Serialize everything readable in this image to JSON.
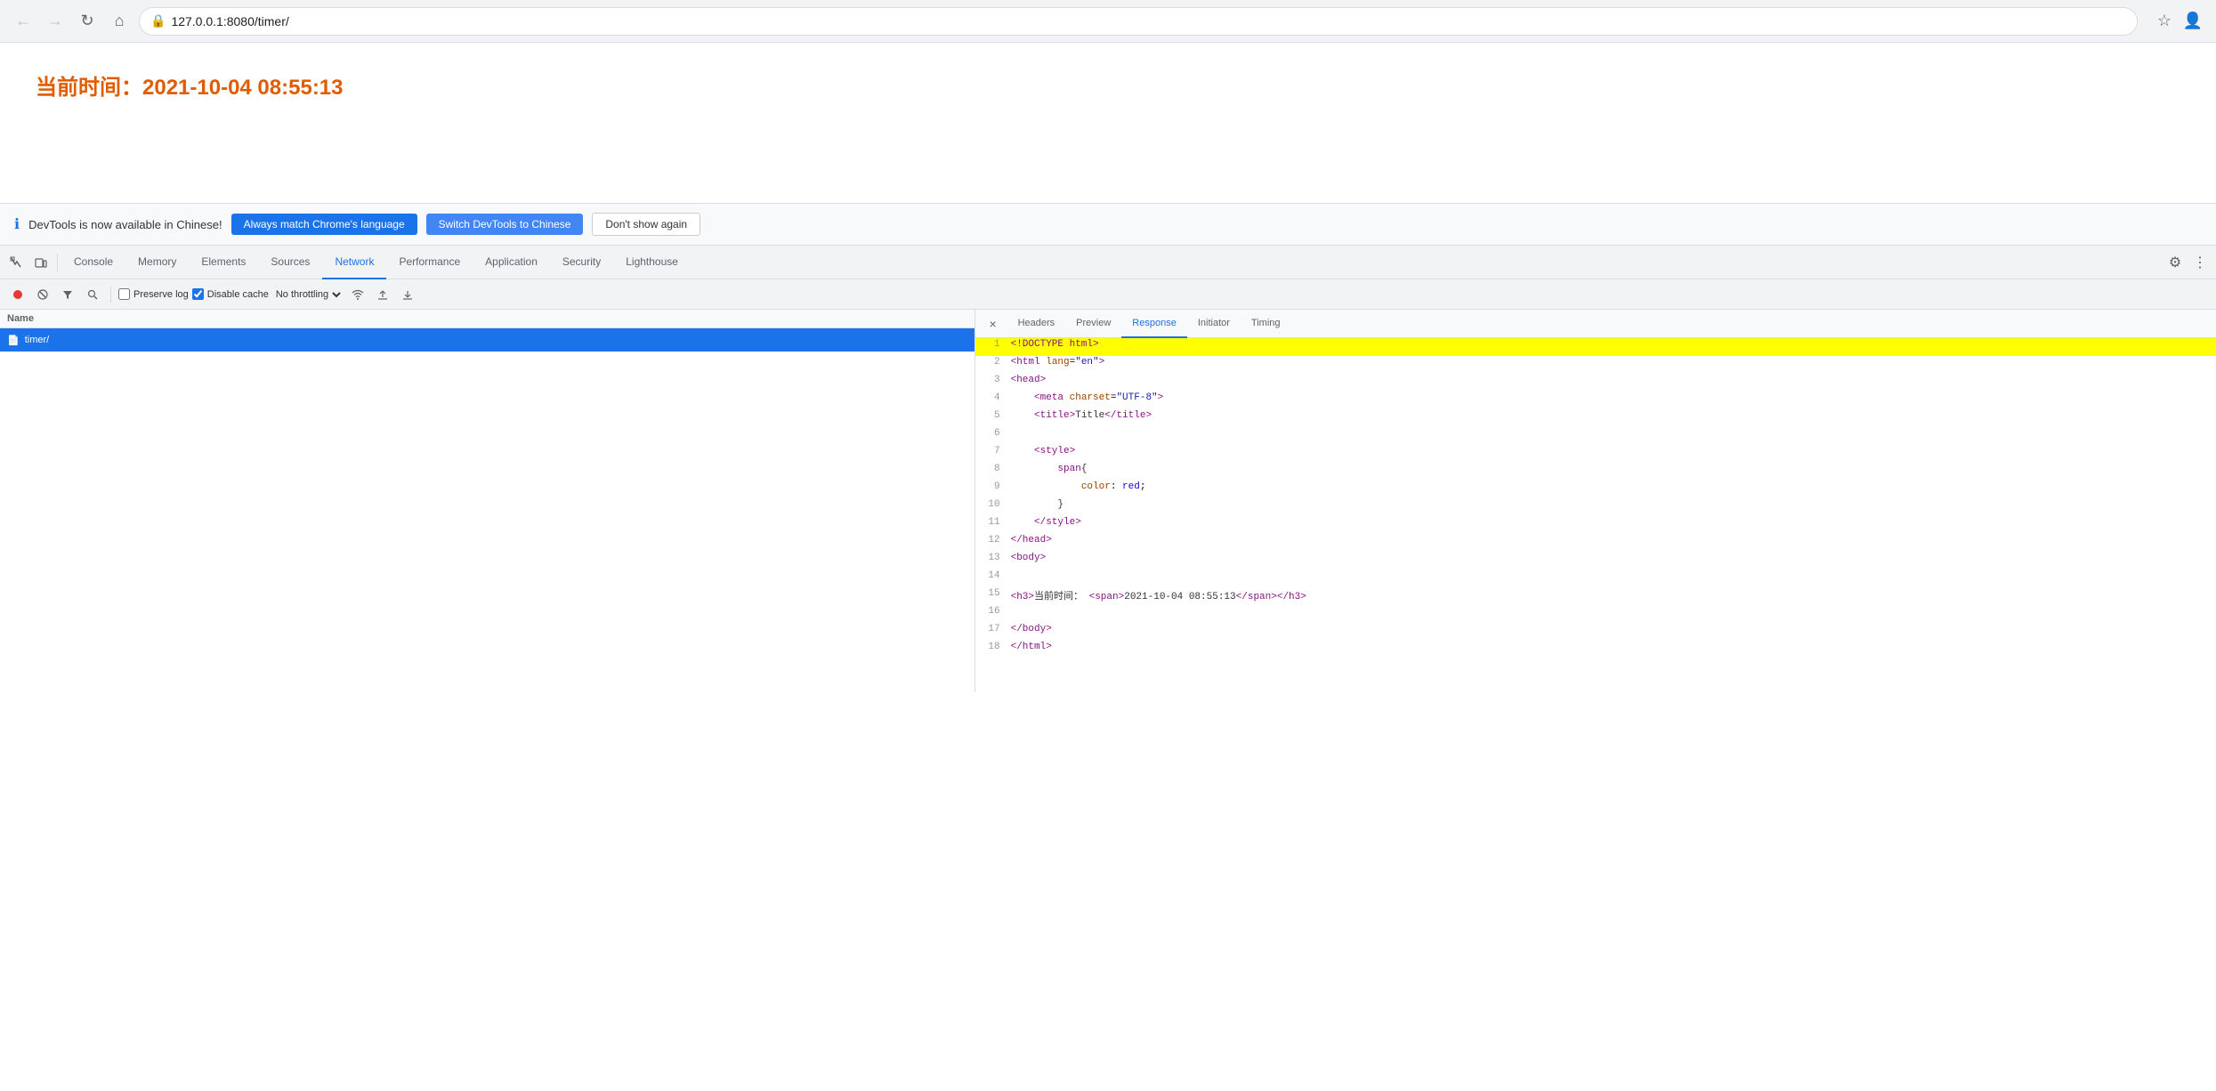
{
  "browser": {
    "url": "127.0.0.1:8080/timer/",
    "back_btn": "←",
    "forward_btn": "→",
    "reload_btn": "↺",
    "home_btn": "⌂",
    "star_btn": "☆",
    "profile_btn": "👤"
  },
  "page": {
    "title_prefix": "当前时间：",
    "title_time": "2021-10-04 08:55:13"
  },
  "banner": {
    "info_icon": "ℹ",
    "message": "DevTools is now available in Chinese!",
    "btn1_label": "Always match Chrome's language",
    "btn2_label": "Switch DevTools to Chinese",
    "btn3_label": "Don't show again"
  },
  "devtools": {
    "tabs": [
      {
        "id": "console",
        "label": "Console",
        "active": false
      },
      {
        "id": "memory",
        "label": "Memory",
        "active": false
      },
      {
        "id": "elements",
        "label": "Elements",
        "active": false
      },
      {
        "id": "sources",
        "label": "Sources",
        "active": false
      },
      {
        "id": "network",
        "label": "Network",
        "active": true
      },
      {
        "id": "performance",
        "label": "Performance",
        "active": false
      },
      {
        "id": "application",
        "label": "Application",
        "active": false
      },
      {
        "id": "security",
        "label": "Security",
        "active": false
      },
      {
        "id": "lighthouse",
        "label": "Lighthouse",
        "active": false
      }
    ],
    "toolbar": {
      "preserve_log": "Preserve log",
      "disable_cache": "Disable cache",
      "throttle_label": "No throttling"
    },
    "network_list": {
      "column_header": "Name",
      "items": [
        {
          "id": "timer",
          "name": "timer/",
          "icon": "📄",
          "selected": true
        }
      ]
    },
    "response_panel": {
      "tabs": [
        {
          "id": "headers",
          "label": "Headers",
          "active": false
        },
        {
          "id": "preview",
          "label": "Preview",
          "active": false
        },
        {
          "id": "response",
          "label": "Response",
          "active": true
        },
        {
          "id": "initiator",
          "label": "Initiator",
          "active": false
        },
        {
          "id": "timing",
          "label": "Timing",
          "active": false
        }
      ],
      "code_lines": [
        {
          "num": 1,
          "content": "<!DOCTYPE html>",
          "highlighted": true,
          "type": "doctype"
        },
        {
          "num": 2,
          "content": "<html lang=\"en\">",
          "highlighted": false,
          "type": "tag"
        },
        {
          "num": 3,
          "content": "<head>",
          "highlighted": false,
          "type": "tag"
        },
        {
          "num": 4,
          "content": "    <meta charset=\"UTF-8\">",
          "highlighted": false,
          "type": "tag"
        },
        {
          "num": 5,
          "content": "    <title>Title</title>",
          "highlighted": false,
          "type": "tag"
        },
        {
          "num": 6,
          "content": "",
          "highlighted": false,
          "type": "empty"
        },
        {
          "num": 7,
          "content": "    <style>",
          "highlighted": false,
          "type": "tag"
        },
        {
          "num": 8,
          "content": "        span{",
          "highlighted": false,
          "type": "css"
        },
        {
          "num": 9,
          "content": "            color: red;",
          "highlighted": false,
          "type": "css"
        },
        {
          "num": 10,
          "content": "        }",
          "highlighted": false,
          "type": "css"
        },
        {
          "num": 11,
          "content": "    </style>",
          "highlighted": false,
          "type": "tag"
        },
        {
          "num": 12,
          "content": "</head>",
          "highlighted": false,
          "type": "tag"
        },
        {
          "num": 13,
          "content": "<body>",
          "highlighted": false,
          "type": "tag"
        },
        {
          "num": 14,
          "content": "",
          "highlighted": false,
          "type": "empty"
        },
        {
          "num": 15,
          "content_parts": [
            {
              "text": "<h3>",
              "class": "html-tag"
            },
            {
              "text": "当前时间：",
              "class": "html-text"
            },
            {
              "text": " <span>",
              "class": "html-tag"
            },
            {
              "text": "2021-10-04 08:55:13",
              "class": "html-text"
            },
            {
              "text": "</span>",
              "class": "html-tag"
            },
            {
              "text": "</h3>",
              "class": "html-tag"
            }
          ],
          "highlighted": false,
          "type": "mixed"
        },
        {
          "num": 16,
          "content": "",
          "highlighted": false,
          "type": "empty"
        },
        {
          "num": 17,
          "content": "</body>",
          "highlighted": false,
          "type": "tag"
        },
        {
          "num": 18,
          "content": "</html>",
          "highlighted": false,
          "type": "tag"
        }
      ]
    }
  }
}
